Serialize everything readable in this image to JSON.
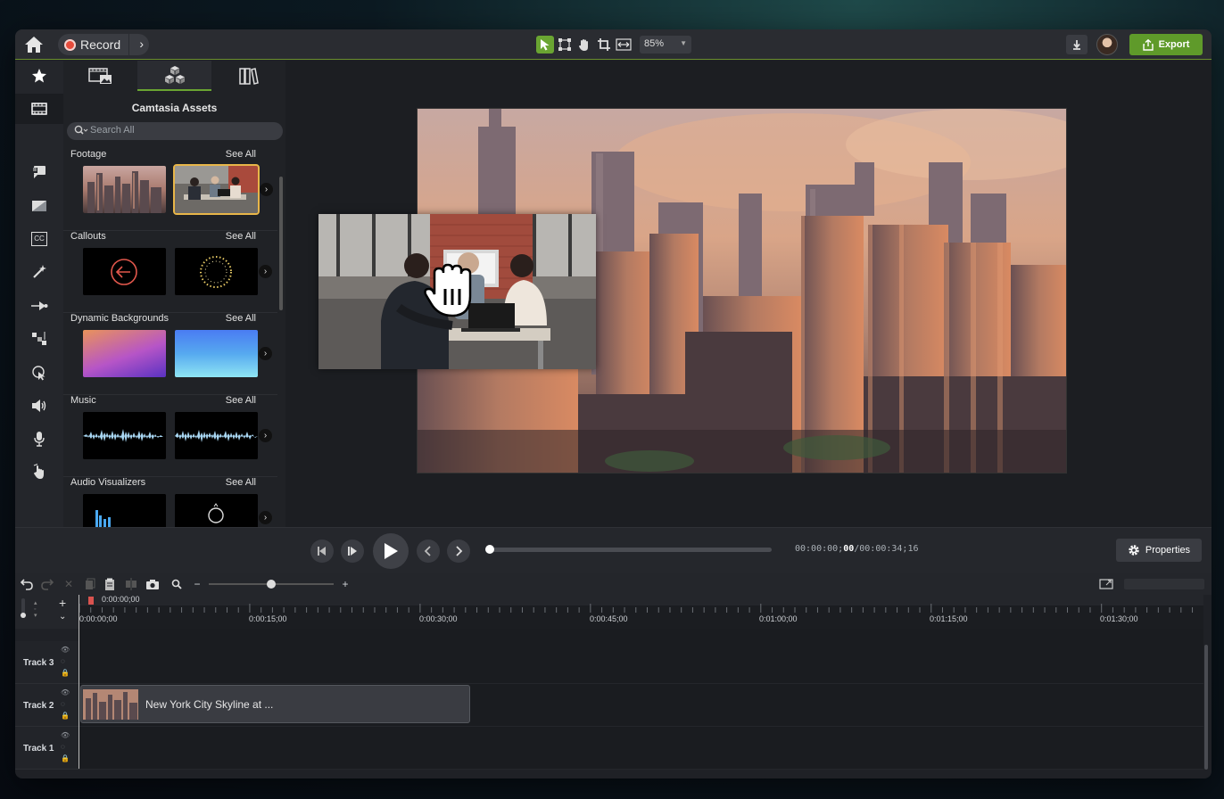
{
  "topbar": {
    "record_label": "Record",
    "zoom_value": "85%",
    "export_label": "Export",
    "tools": [
      "select-arrow-icon",
      "transform-icon",
      "pan-hand-icon",
      "crop-icon",
      "fit-icon"
    ]
  },
  "rail": {
    "items": [
      "favorites-star-icon",
      "media-icon",
      "annotations-icon",
      "transitions-icon",
      "captions-icon",
      "effects-wand-icon",
      "animations-icon",
      "behaviors-icon",
      "cursor-effects-icon",
      "audio-effects-icon",
      "voice-narration-icon",
      "interactivity-icon"
    ]
  },
  "panel": {
    "title": "Camtasia Assets",
    "search_placeholder": "Search All",
    "sections": [
      {
        "title": "Footage",
        "see_all": "See All"
      },
      {
        "title": "Callouts",
        "see_all": "See All"
      },
      {
        "title": "Dynamic Backgrounds",
        "see_all": "See All"
      },
      {
        "title": "Music",
        "see_all": "See All"
      },
      {
        "title": "Audio Visualizers",
        "see_all": "See All"
      }
    ]
  },
  "captions": {
    "caption_icon_text": "CC"
  },
  "playback": {
    "timecode_prefix": "00:00:00;",
    "timecode_bold": "00",
    "timecode_suffix": "/00:00:34;16",
    "properties_label": "Properties"
  },
  "timeline": {
    "playhead_time": "0:00:00;00",
    "ruler_labels": [
      "0:00:00;00",
      "0:00:15;00",
      "0:00:30;00",
      "0:00:45;00",
      "0:01:00;00",
      "0:01:15;00",
      "0:01:30;00"
    ],
    "tracks": [
      {
        "name": "Track 3"
      },
      {
        "name": "Track 2"
      },
      {
        "name": "Track 1"
      }
    ],
    "clip_name": "New York City Skyline at ..."
  },
  "colors": {
    "accent_green": "#6aa532",
    "export_green": "#5f9a2a",
    "record_red": "#e74c3c",
    "selection_gold": "#e8b649"
  }
}
